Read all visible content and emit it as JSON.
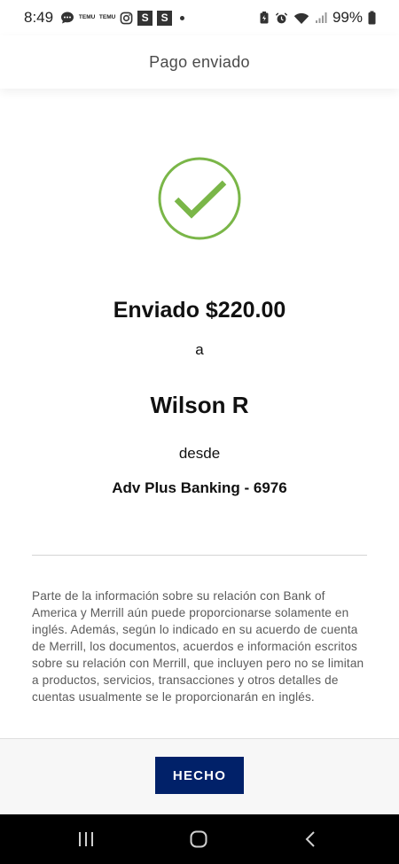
{
  "status_bar": {
    "time": "8:49",
    "temu_label_1": "TEMU",
    "temu_label_2": "TEMU",
    "s_badge_1": "S",
    "s_badge_2": "S",
    "battery": "99%"
  },
  "header": {
    "title": "Pago enviado"
  },
  "confirmation": {
    "icon": "check-circle-icon",
    "icon_color": "#7ab648",
    "amount_line": "Enviado $220.00",
    "to_label": "a",
    "recipient": "Wilson R",
    "from_label": "desde",
    "account": "Adv Plus Banking - 6976"
  },
  "disclaimer": {
    "text": "Parte de la información sobre su relación con Bank of America y Merrill aún puede proporcionarse solamente en inglés. Además, según lo indicado en su acuerdo de cuenta de Merrill, los documentos, acuerdos e información escritos sobre su relación con Merrill, que incluyen pero no se limitan a productos, servicios, transacciones y otros detalles de cuentas usualmente se le proporcionarán en inglés."
  },
  "footer": {
    "done_label": "HECHO",
    "button_color": "#012169"
  },
  "nav_bar": {
    "recents_icon": "recents-icon",
    "home_icon": "home-icon",
    "back_icon": "back-icon"
  }
}
